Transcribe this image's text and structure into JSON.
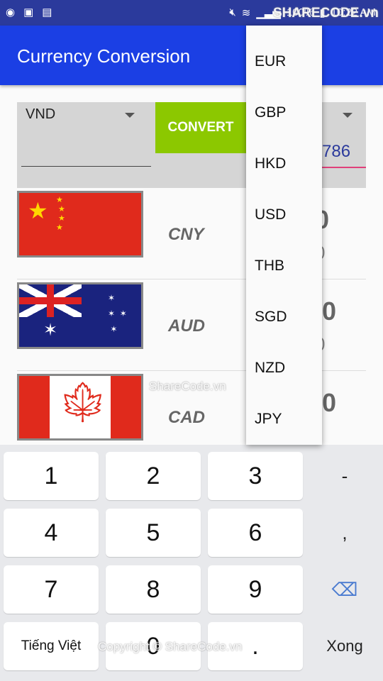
{
  "status": {
    "time": "10:22 AM",
    "battery": "100%",
    "icons": [
      "messenger-icon",
      "image-icon",
      "keyboard-icon",
      "mute-icon",
      "wifi-icon",
      "signal-icon",
      "battery-icon"
    ]
  },
  "app": {
    "title": "Currency Conversion"
  },
  "form": {
    "from_currency": "VND",
    "convert_label": "CONVERT",
    "amount_value": "786",
    "convert_color": "#8cc800",
    "accent": "#e0407a"
  },
  "rows": [
    {
      "code": "CNY",
      "value": "0",
      "sub": "0"
    },
    {
      "code": "AUD",
      "value": ".0",
      "sub": "0"
    },
    {
      "code": "CAD",
      "value": ".0",
      "sub": ""
    }
  ],
  "dropdown": {
    "options": [
      "EUR",
      "GBP",
      "HKD",
      "USD",
      "THB",
      "SGD",
      "NZD",
      "JPY"
    ]
  },
  "keyboard": {
    "keys": [
      "1",
      "2",
      "3",
      "4",
      "5",
      "6",
      "7",
      "8",
      "9",
      "Tiếng Việt",
      "0",
      "."
    ],
    "side": [
      "-",
      ",",
      "backspace",
      "Xong"
    ]
  },
  "watermarks": {
    "logo": "SHARECODE.vn",
    "center": "ShareCode.vn",
    "bottom": "Copyright © ShareCode.vn"
  }
}
